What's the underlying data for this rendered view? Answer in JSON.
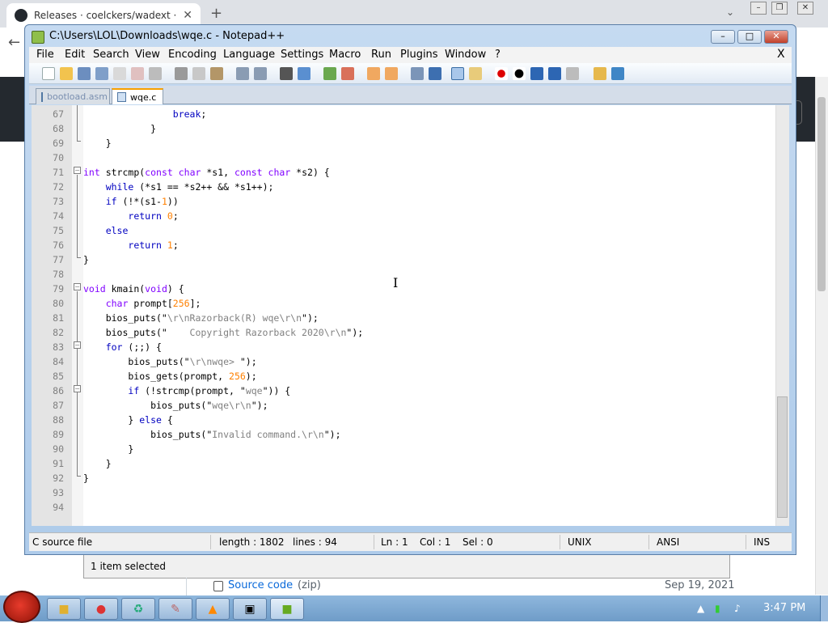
{
  "browser": {
    "tab_title": "Releases · coelckers/wadext · C",
    "new_tab_glyph": "+",
    "close_glyph": "✕",
    "download_status": "1 item selected",
    "release": {
      "source_code_label": "Source code",
      "source_code_format": "(zip)",
      "date": "Sep 19, 2021"
    }
  },
  "notepad": {
    "title": "C:\\Users\\LOL\\Downloads\\wqe.c - Notepad++",
    "menu": [
      "File",
      "Edit",
      "Search",
      "View",
      "Encoding",
      "Language",
      "Settings",
      "Macro",
      "Run",
      "Plugins",
      "Window",
      "?"
    ],
    "close_doc": "X",
    "tabs": [
      {
        "label": "bootload.asm",
        "active": false
      },
      {
        "label": "wqe.c",
        "active": true
      }
    ],
    "code_lines": [
      {
        "n": "67",
        "html": "                <span class=\"kw\">break</span>;"
      },
      {
        "n": "68",
        "html": "            }"
      },
      {
        "n": "69",
        "html": "    }"
      },
      {
        "n": "70",
        "html": ""
      },
      {
        "n": "71",
        "html": "<span class=\"ty\">int</span> strcmp(<span class=\"ty\">const</span> <span class=\"ty\">char</span> *s1, <span class=\"ty\">const</span> <span class=\"ty\">char</span> *s2) {"
      },
      {
        "n": "72",
        "html": "    <span class=\"kw\">while</span> (*s1 == *s2++ &amp;&amp; *s1++);"
      },
      {
        "n": "73",
        "html": "    <span class=\"kw\">if</span> (!*(s1-<span class=\"num\">1</span>))"
      },
      {
        "n": "74",
        "html": "        <span class=\"kw\">return</span> <span class=\"num\">0</span>;"
      },
      {
        "n": "75",
        "html": "    <span class=\"kw\">else</span>"
      },
      {
        "n": "76",
        "html": "        <span class=\"kw\">return</span> <span class=\"num\">1</span>;"
      },
      {
        "n": "77",
        "html": "}"
      },
      {
        "n": "78",
        "html": ""
      },
      {
        "n": "79",
        "html": "<span class=\"ty\">void</span> kmain(<span class=\"ty\">void</span>) {"
      },
      {
        "n": "80",
        "html": "    <span class=\"ty\">char</span> prompt[<span class=\"num\">256</span>];"
      },
      {
        "n": "81",
        "html": "    bios_puts(\"<span class=\"str\">\\r\\nRazorback(R) wqe\\r\\n</span>\");"
      },
      {
        "n": "82",
        "html": "    bios_puts(\"<span class=\"str\">    Copyright Razorback 2020\\r\\n</span>\");"
      },
      {
        "n": "83",
        "html": "    <span class=\"kw\">for</span> (;;) {"
      },
      {
        "n": "84",
        "html": "        bios_puts(\"<span class=\"str\">\\r\\nwqe&gt; </span>\");"
      },
      {
        "n": "85",
        "html": "        bios_gets(prompt, <span class=\"num\">256</span>);"
      },
      {
        "n": "86",
        "html": "        <span class=\"kw\">if</span> (!strcmp(prompt, \"<span class=\"str\">wqe</span>\")) {"
      },
      {
        "n": "87",
        "html": "            bios_puts(\"<span class=\"str\">wqe\\r\\n</span>\");"
      },
      {
        "n": "88",
        "html": "        } <span class=\"kw\">else</span> {"
      },
      {
        "n": "89",
        "html": "            bios_puts(\"<span class=\"str\">Invalid command.\\r\\n</span>\");"
      },
      {
        "n": "90",
        "html": "        }"
      },
      {
        "n": "91",
        "html": "    }"
      },
      {
        "n": "92",
        "html": "}"
      },
      {
        "n": "93",
        "html": ""
      },
      {
        "n": "94",
        "html": ""
      }
    ],
    "status": {
      "file_type": "C source file",
      "length": "length : 1802",
      "lines": "lines : 94",
      "ln": "Ln : 1",
      "col": "Col : 1",
      "sel": "Sel : 0",
      "eol": "UNIX",
      "encoding": "ANSI",
      "mode": "INS"
    }
  },
  "taskbar": {
    "time": "3:47 PM",
    "tray_arrow": "▲"
  }
}
